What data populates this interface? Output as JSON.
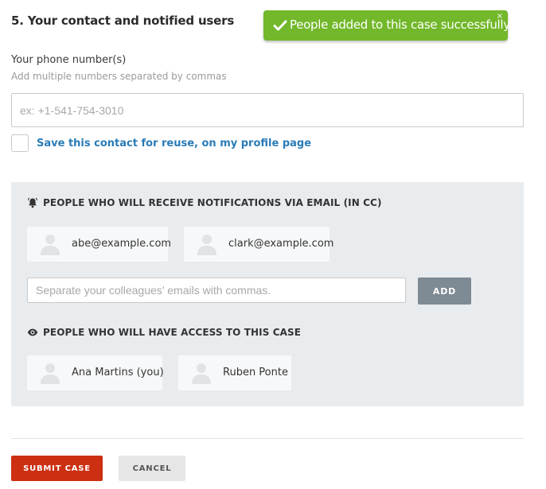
{
  "section": {
    "title": "5. Your contact and notified users"
  },
  "toast": {
    "message": "People added to this case successfully.",
    "close_label": "×",
    "color": "#72b82a"
  },
  "phone": {
    "label": "Your phone number(s)",
    "hint": "Add multiple numbers separated by commas",
    "placeholder": "ex: +1-541-754-3010",
    "value": ""
  },
  "save_contact": {
    "label": "Save this contact for reuse, on my profile page",
    "checked": false
  },
  "email_notifications": {
    "heading": "PEOPLE WHO WILL RECEIVE NOTIFICATIONS VIA EMAIL (IN CC)",
    "icon": "bell-icon",
    "people": [
      {
        "name": "abe@example.com"
      },
      {
        "name": "clark@example.com"
      }
    ],
    "input_placeholder": "Separate your colleagues’ emails with commas.",
    "add_label": "ADD"
  },
  "access": {
    "heading": "PEOPLE WHO WILL HAVE ACCESS TO THIS CASE",
    "icon": "eye-icon",
    "people": [
      {
        "name": "Ana Martins (you)"
      },
      {
        "name": "Ruben Ponte"
      }
    ]
  },
  "actions": {
    "submit_label": "SUBMIT CASE",
    "cancel_label": "CANCEL",
    "submit_color": "#cc2f12"
  }
}
